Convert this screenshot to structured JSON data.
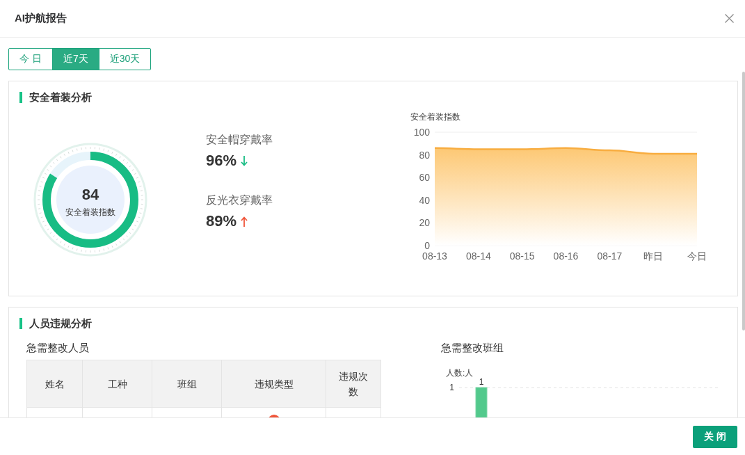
{
  "dialog": {
    "title": "AI护航报告"
  },
  "range_tabs": [
    {
      "label": "今 日",
      "selected": false
    },
    {
      "label": "近7天",
      "selected": true
    },
    {
      "label": "近30天",
      "selected": false
    }
  ],
  "safety_attire": {
    "title": "安全着装分析",
    "gauge": {
      "value": "84",
      "label": "安全着装指数",
      "level": 0.84
    },
    "rates": [
      {
        "label": "安全帽穿戴率",
        "value": "96%",
        "rising": false
      },
      {
        "label": "反光衣穿戴率",
        "value": "89%",
        "rising": true
      }
    ],
    "chart_data": {
      "type": "area",
      "ylabel": "安全着装指数",
      "categories": [
        "08-13",
        "08-14",
        "08-15",
        "08-16",
        "08-17",
        "昨日",
        "今日"
      ],
      "values": [
        86,
        85,
        85,
        86,
        84,
        81,
        81
      ],
      "ylim": [
        0,
        100
      ],
      "yticks": [
        0,
        20,
        40,
        60,
        80,
        100
      ]
    }
  },
  "violations": {
    "title": "人员违规分析",
    "people": {
      "title": "急需整改人员",
      "columns": [
        "姓名",
        "工种",
        "班组",
        "违规类型",
        "违规次数"
      ],
      "rows": [
        {
          "badge": true
        }
      ]
    },
    "teams": {
      "title": "急需整改班组",
      "axis_title": "人数:人",
      "axis_tick": "1",
      "bar_labels": [
        "1"
      ]
    }
  },
  "footer": {
    "buttons": [
      "关 闭"
    ]
  }
}
